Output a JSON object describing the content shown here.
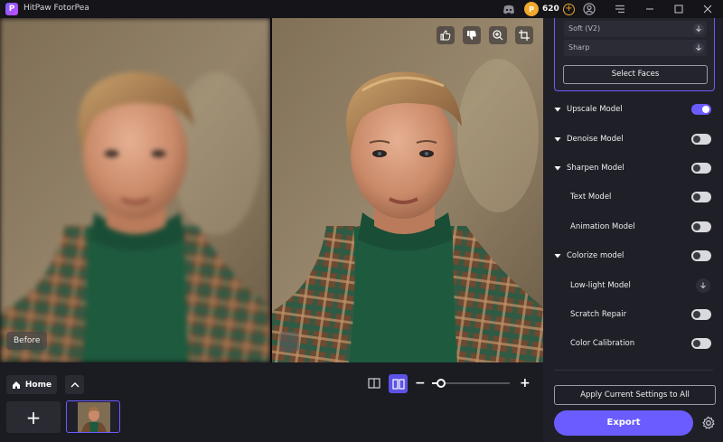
{
  "app": {
    "title": "HitPaw FotorPea",
    "logo_letter": "P",
    "credits": "620",
    "coin_letter": "P",
    "accent": "#6b5cff"
  },
  "preview": {
    "before_label": "Before"
  },
  "bottombar": {
    "home_label": "Home",
    "add_label": "+",
    "zoom_minus": "−",
    "zoom_plus": "+",
    "zoom_level": 0.12
  },
  "face_options": [
    {
      "label": "Soft (V2)"
    },
    {
      "label": "Sharp"
    }
  ],
  "select_faces_label": "Select Faces",
  "models": [
    {
      "label": "Upscale Model",
      "expandable": true,
      "on": true
    },
    {
      "label": "Denoise Model",
      "expandable": true,
      "on": false
    },
    {
      "label": "Sharpen Model",
      "expandable": true,
      "on": false
    },
    {
      "label": "Text Model",
      "expandable": false,
      "on": false
    },
    {
      "label": "Animation Model",
      "expandable": false,
      "on": false
    },
    {
      "label": "Colorize model",
      "expandable": true,
      "on": false
    },
    {
      "label": "Low-light Model",
      "expandable": false,
      "download": true
    },
    {
      "label": "Scratch Repair",
      "expandable": false,
      "on": false
    },
    {
      "label": "Color Calibration",
      "expandable": false,
      "on": false
    }
  ],
  "apply_label": "Apply Current Settings to All",
  "export_label": "Export"
}
